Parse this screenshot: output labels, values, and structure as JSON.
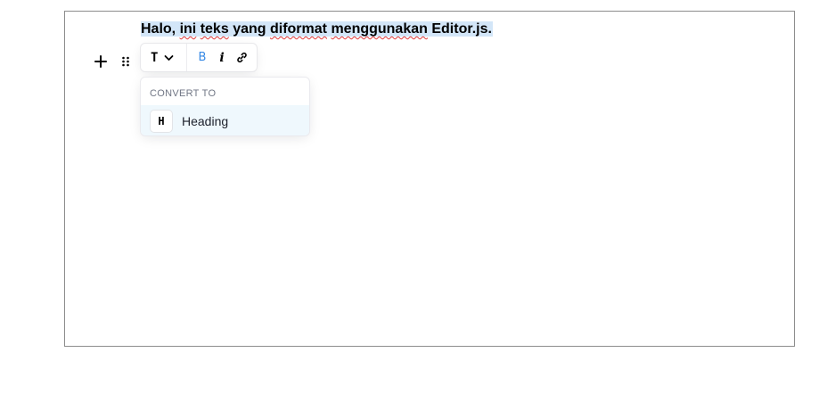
{
  "editor": {
    "paragraph_words": [
      "Halo,",
      "ini",
      "teks",
      "yang",
      "diformat",
      "menggunakan",
      "Editor.js."
    ],
    "misspelled_word_indexes": [
      1,
      2,
      4,
      5
    ]
  },
  "block_actions": {
    "plus_icon": "plus-icon",
    "drag_icon": "drag-handle-icon"
  },
  "inline_toolbar": {
    "convert_icon_glyph": "T",
    "bold_glyph": "B",
    "italic_glyph": "i",
    "bold_color": "#388ae5"
  },
  "convert_popover": {
    "title": "CONVERT TO",
    "items": [
      {
        "icon_glyph": "H",
        "label": "Heading"
      }
    ],
    "highlight_color": "#eff8fd"
  },
  "colors": {
    "selection": "#d3e6f8",
    "spellcheck_underline": "#e03a3a",
    "frame_border": "#8c8c8c"
  }
}
